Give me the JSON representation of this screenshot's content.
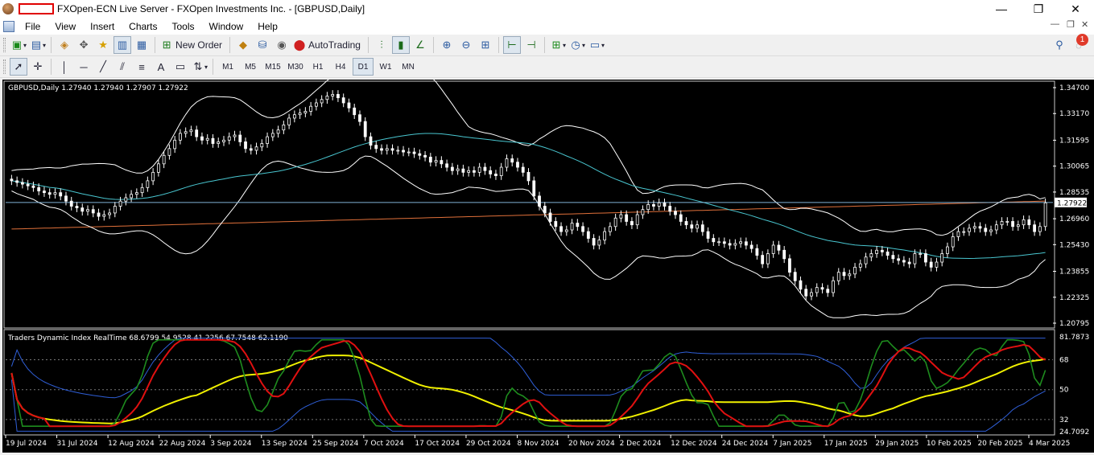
{
  "window": {
    "title": "FXOpen-ECN Live Server - FXOpen Investments Inc. - [GBPUSD,Daily]",
    "controls": [
      "—",
      "❐",
      "✕"
    ]
  },
  "menu": [
    "File",
    "View",
    "Insert",
    "Charts",
    "Tools",
    "Window",
    "Help"
  ],
  "toolbar1": {
    "new_order_label": "New Order",
    "autotrading_label": "AutoTrading",
    "notifications_count": "1"
  },
  "timeframes": [
    "M1",
    "M5",
    "M15",
    "M30",
    "H1",
    "H4",
    "D1",
    "W1",
    "MN"
  ],
  "active_timeframe": "D1",
  "colors": {
    "chart_bg": "#000000",
    "bull_candle": "#ffffff",
    "bear_candle": "#ffffff",
    "bollinger": "#ffffff",
    "ma_aqua": "#49c6d0",
    "ma_orange": "#e0703a",
    "price_line": "#7fb2d6",
    "tdi_green": "#1e8c1e",
    "tdi_red": "#e01010",
    "tdi_yellow": "#f0f000",
    "tdi_blue": "#2f5fd8"
  },
  "main_chart": {
    "header": "GBPUSD,Daily  1.27940 1.27940 1.27907 1.27922",
    "price_axis": [
      "1.34700",
      "1.33170",
      "1.31595",
      "1.30065",
      "1.28535",
      "1.26960",
      "1.25430",
      "1.23855",
      "1.22325",
      "1.20795"
    ],
    "current_price": "1.27922"
  },
  "indicator": {
    "header": "Traders Dynamic Index RealTime 68.6799 54.9528 41.2256 67.7548 62.1190",
    "axis": [
      "81.7873",
      "68",
      "50",
      "32",
      "24.7092"
    ]
  },
  "time_axis": [
    "19 Jul 2024",
    "31 Jul 2024",
    "12 Aug 2024",
    "22 Aug 2024",
    "3 Sep 2024",
    "13 Sep 2024",
    "25 Sep 2024",
    "7 Oct 2024",
    "17 Oct 2024",
    "29 Oct 2024",
    "8 Nov 2024",
    "20 Nov 2024",
    "2 Dec 2024",
    "12 Dec 2024",
    "24 Dec 2024",
    "7 Jan 2025",
    "17 Jan 2025",
    "29 Jan 2025",
    "10 Feb 2025",
    "20 Feb 2025",
    "4 Mar 2025"
  ],
  "chart_data": {
    "type": "candlestick",
    "symbol": "GBPUSD",
    "timeframe": "Daily",
    "ylim": [
      1.20795,
      1.347
    ],
    "close_series": [
      1.292,
      1.291,
      1.29,
      1.289,
      1.288,
      1.286,
      1.285,
      1.284,
      1.285,
      1.283,
      1.28,
      1.277,
      1.276,
      1.274,
      1.275,
      1.273,
      1.271,
      1.272,
      1.273,
      1.277,
      1.28,
      1.282,
      1.284,
      1.285,
      1.288,
      1.292,
      1.297,
      1.302,
      1.307,
      1.311,
      1.316,
      1.32,
      1.321,
      1.322,
      1.318,
      1.316,
      1.317,
      1.314,
      1.315,
      1.316,
      1.318,
      1.319,
      1.315,
      1.311,
      1.31,
      1.312,
      1.314,
      1.318,
      1.32,
      1.322,
      1.325,
      1.329,
      1.331,
      1.332,
      1.333,
      1.336,
      1.338,
      1.34,
      1.342,
      1.343,
      1.341,
      1.338,
      1.335,
      1.331,
      1.327,
      1.318,
      1.313,
      1.311,
      1.31,
      1.311,
      1.31,
      1.31,
      1.309,
      1.309,
      1.308,
      1.307,
      1.306,
      1.303,
      1.304,
      1.302,
      1.3,
      1.298,
      1.299,
      1.297,
      1.298,
      1.297,
      1.3,
      1.298,
      1.296,
      1.295,
      1.3,
      1.305,
      1.303,
      1.3,
      1.297,
      1.292,
      1.283,
      1.277,
      1.273,
      1.268,
      1.265,
      1.262,
      1.263,
      1.267,
      1.265,
      1.262,
      1.258,
      1.254,
      1.257,
      1.262,
      1.265,
      1.27,
      1.272,
      1.268,
      1.266,
      1.272,
      1.275,
      1.278,
      1.277,
      1.279,
      1.277,
      1.274,
      1.272,
      1.268,
      1.266,
      1.264,
      1.266,
      1.262,
      1.258,
      1.256,
      1.256,
      1.255,
      1.254,
      1.255,
      1.256,
      1.254,
      1.252,
      1.248,
      1.243,
      1.249,
      1.254,
      1.251,
      1.246,
      1.238,
      1.233,
      1.228,
      1.224,
      1.226,
      1.229,
      1.228,
      1.226,
      1.233,
      1.238,
      1.236,
      1.237,
      1.241,
      1.243,
      1.247,
      1.249,
      1.251,
      1.25,
      1.248,
      1.246,
      1.245,
      1.244,
      1.243,
      1.249,
      1.249,
      1.244,
      1.241,
      1.244,
      1.249,
      1.253,
      1.259,
      1.262,
      1.262,
      1.264,
      1.265,
      1.264,
      1.262,
      1.263,
      1.266,
      1.268,
      1.268,
      1.265,
      1.266,
      1.269,
      1.266,
      1.262,
      1.265,
      1.279
    ]
  }
}
